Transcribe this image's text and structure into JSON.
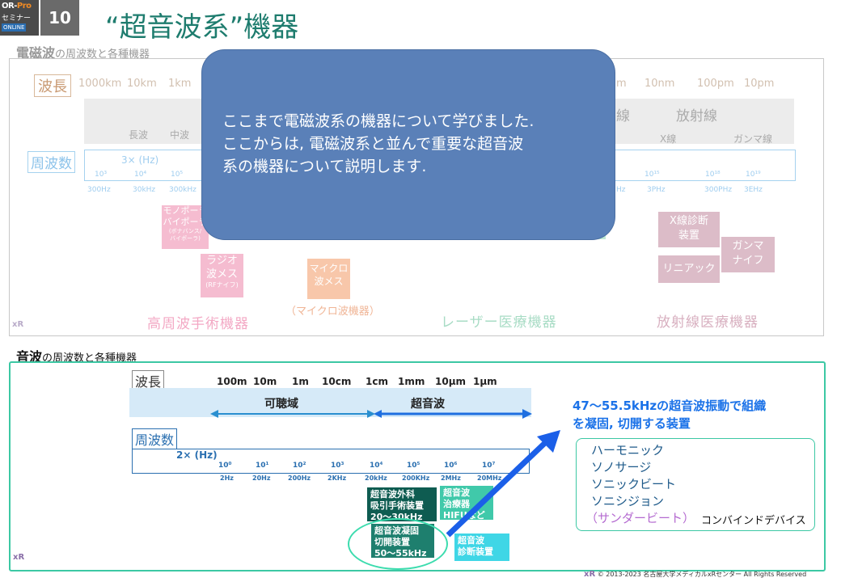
{
  "header": {
    "logo": {
      "line1_a": "OR-",
      "line1_b": "Pro",
      "line2": "セミナー",
      "line3": "ONLINE"
    },
    "slide_number": "10",
    "title": "“超音波系”機器"
  },
  "em_section": {
    "heading_bold": "電磁波",
    "heading_rest": "の周波数と各種機器",
    "wavelength_label": "波長",
    "wavelengths_left": [
      "1000km",
      "10km",
      "1km"
    ],
    "wavelengths_right": [
      "m",
      "10nm",
      "100pm",
      "10pm"
    ],
    "band_right_1": "線",
    "band_right_2": "放射線",
    "band_sub_left": [
      "長波",
      "中波"
    ],
    "band_sub_right": [
      "X線",
      "ガンマ線"
    ],
    "frequency_label": "周波数",
    "freq_multiplier": "3× (Hz)",
    "freq_exp_left": [
      "10³",
      "10⁴",
      "10⁵"
    ],
    "freq_units_left": [
      "300Hz",
      "30kHz",
      "300kHz"
    ],
    "freq_exp_right": [
      "10¹⁵",
      "10¹⁸",
      "10¹⁹"
    ],
    "freq_units_right": [
      "Hz",
      "3PHz",
      "300PHz",
      "3EHz"
    ],
    "devices": {
      "mono_bipolar": [
        "モノポーラ",
        "バイポーラ",
        "(ボナバンス/",
        "バイポーラ)"
      ],
      "radio_knife": [
        "ラジオ",
        "波メス",
        "(RFナイフ)"
      ],
      "microwave": [
        "マイクロ",
        "波メス"
      ],
      "microwave_caption": "（マイクロ波機器）",
      "xray": [
        "X線診断",
        "装置"
      ],
      "gamma": [
        "ガンマ",
        "ナイフ"
      ],
      "linac": "リニアック"
    },
    "categories": [
      "高周波手術機器",
      "レーザー医療機器",
      "放射線医療機器"
    ],
    "xr_mark": "xR"
  },
  "popup": {
    "text_lines": [
      "ここまで電磁波系の機器について学びました.",
      "ここからは, 電磁波系と並んで重要な超音波",
      "系の機器について説明します."
    ]
  },
  "us_section": {
    "heading_bold": "音波",
    "heading_rest": "の周波数と各種機器",
    "wavelength_label": "波長",
    "wavelengths": [
      "100m",
      "10m",
      "1m",
      "10cm",
      "1cm",
      "1mm",
      "10μm",
      "1μm"
    ],
    "audible": "可聴域",
    "ultrasonic": "超音波",
    "frequency_label": "周波数",
    "freq_multiplier": "2×  (Hz)",
    "freq_exps": [
      "10⁰",
      "10¹",
      "10²",
      "10³",
      "10⁴",
      "10⁵",
      "10⁶",
      "10⁷"
    ],
    "freq_units": [
      "2Hz",
      "20Hz",
      "200Hz",
      "2KHz",
      "20kHz",
      "200KHz",
      "2MHz",
      "20MHz"
    ],
    "devices": {
      "suction": [
        "超音波外科",
        "吸引手術装置",
        "20～30kHz"
      ],
      "therapy": [
        "超音波",
        "治療器",
        "HIFUなど"
      ],
      "coag": [
        "超音波凝固",
        "切開装置",
        "50～55kHz"
      ],
      "diag": [
        "超音波",
        "診断装置"
      ]
    },
    "note": [
      "47～55.5kHzの超音波振動で組織",
      "を凝固, 切開する装置"
    ],
    "product_names": [
      "ハーモニック",
      "ソノサージ",
      "ソニックビート",
      "ソニシジョン"
    ],
    "product_last": "（サンダービート）",
    "combined_device": "コンバインドデバイス",
    "xr_mark": "xR"
  },
  "footer": {
    "xr_mark": "xR",
    "copyright": "© 2013-2023  名古屋大学メディカルxRセンター   All Rights Reserved"
  },
  "colors": {
    "title": "#1e7c6e",
    "popup": "#5a80b8",
    "us_border": "#3cc8a4",
    "note_blue": "#1b72e8"
  }
}
